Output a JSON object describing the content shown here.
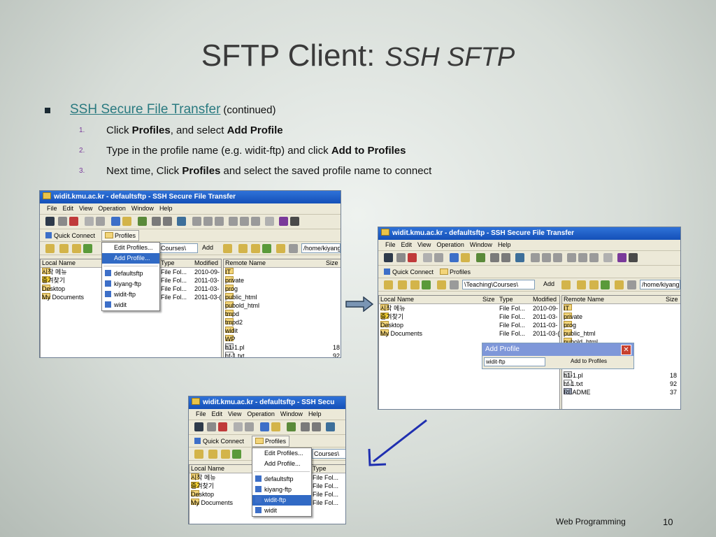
{
  "slide": {
    "title_main": "SFTP Client:",
    "title_sub": "SSH SFTP",
    "bullet": {
      "link": "SSH Secure File Transfer",
      "suffix": "(continued)"
    },
    "steps": [
      {
        "num": "1.",
        "pre": "Click ",
        "b1": "Profiles",
        "mid": ", and select ",
        "b2": "Add Profile",
        "post": ""
      },
      {
        "num": "2.",
        "pre": "Type in the profile name (e.g. widit-ftp) and click ",
        "b1": "Add to Profiles",
        "mid": "",
        "b2": "",
        "post": ""
      },
      {
        "num": "3.",
        "pre": "Next time, Click ",
        "b1": "Profiles",
        "mid": " and select the saved profile name to connect",
        "b2": "",
        "post": ""
      }
    ],
    "footer_label": "Web Programming",
    "page_number": "10"
  },
  "app": {
    "title": "widit.kmu.ac.kr - defaultsftp - SSH Secure File Transfer",
    "title_short": "widit.kmu.ac.kr - defaultsftp - SSH Secu",
    "menu": [
      "File",
      "Edit",
      "View",
      "Operation",
      "Window",
      "Help"
    ],
    "quick_connect": "Quick Connect",
    "profiles": "Profiles",
    "local_path": "\\Teaching\\Courses\\",
    "local_path_short": "Courses\\",
    "add_label": "Add",
    "remote_path": "/home/kiyang",
    "local_headers": {
      "name": "Local Name",
      "size": "Size",
      "type": "Type",
      "modified": "Modified"
    },
    "remote_headers": {
      "name": "Remote Name",
      "size": "Size"
    },
    "local_files": [
      {
        "name": "시작 메뉴",
        "type": "File Fol...",
        "modified": "2010-09-"
      },
      {
        "name": "즐겨찾기",
        "type": "File Fol...",
        "modified": "2011-03-"
      },
      {
        "name": "Desktop",
        "type": "File Fol...",
        "modified": "2011-03-"
      },
      {
        "name": "My Documents",
        "type": "File Fol...",
        "modified": "2011-03-("
      }
    ],
    "remote_files": [
      {
        "name": "IT",
        "size": ""
      },
      {
        "name": "private",
        "size": ""
      },
      {
        "name": "prog",
        "size": ""
      },
      {
        "name": "public_html",
        "size": ""
      },
      {
        "name": "pubold_html",
        "size": ""
      },
      {
        "name": "tmpd",
        "size": ""
      },
      {
        "name": "tmpd2",
        "size": ""
      },
      {
        "name": "widit",
        "size": ""
      },
      {
        "name": "WP",
        "size": ""
      },
      {
        "name": "h1-1.pl",
        "size": "18"
      },
      {
        "name": "hf-1.txt",
        "size": "92"
      }
    ],
    "remote_files_right_bottom": [
      {
        "name": "WP",
        "size": ""
      },
      {
        "name": "h1-1.pl",
        "size": "18"
      },
      {
        "name": "hf-1.txt",
        "size": "92"
      },
      {
        "name": "README",
        "size": "37"
      }
    ],
    "profiles_menu": [
      "Edit Profiles...",
      "Add Profile...",
      "defaultsftp",
      "kiyang-ftp",
      "widit-ftp",
      "widit"
    ],
    "dialog": {
      "title": "Add Profile",
      "input_value": "widit-ftp",
      "button": "Add to Profiles"
    }
  }
}
